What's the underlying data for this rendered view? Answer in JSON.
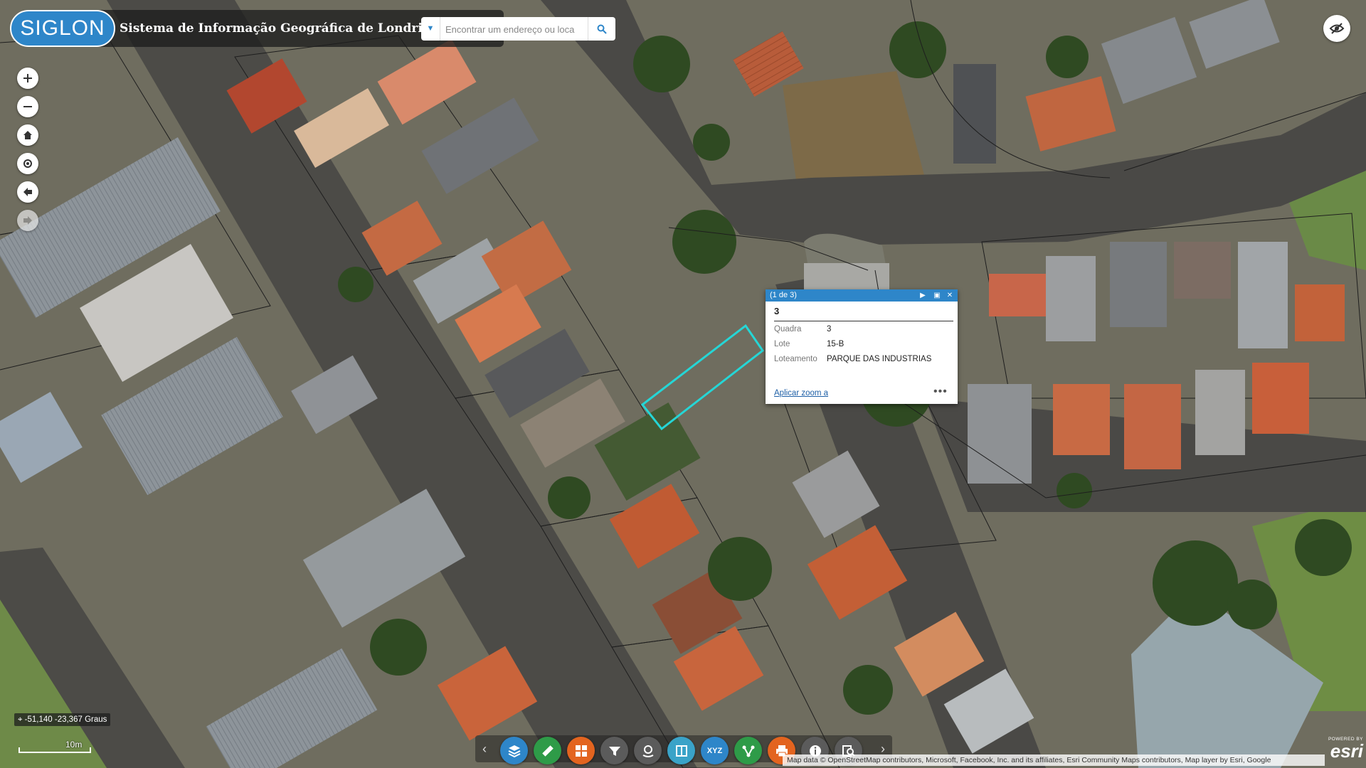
{
  "header": {
    "logo_text": "SIGLON",
    "title": "Sistema de Informação Geográfica de Londrina",
    "search_placeholder": "Encontrar um endereço ou loca"
  },
  "popup": {
    "counter": "(1 de 3)",
    "title": "3",
    "attributes": [
      {
        "label": "Quadra",
        "value": "3"
      },
      {
        "label": "Lote",
        "value": "15-B"
      },
      {
        "label": "Loteamento",
        "value": "PARQUE DAS INDUSTRIAS"
      }
    ],
    "zoom_link": "Aplicar zoom a",
    "more": "•••"
  },
  "coordinates": "-51,140 -23,367 Graus",
  "scale_label": "10m",
  "attribution": "Map data © OpenStreetMap contributors, Microsoft, Facebook, Inc. and its affiliates, Esri Community Maps contributors, Map layer by Esri, Google",
  "esri": {
    "powered_by": "POWERED BY",
    "logo": "esri"
  },
  "toolbar": {
    "tools": [
      {
        "name": "layers-icon",
        "color": "#2e86c9"
      },
      {
        "name": "measure-icon",
        "color": "#2e9b48"
      },
      {
        "name": "basemap-gallery-icon",
        "color": "#e3641f"
      },
      {
        "name": "filter-icon",
        "color": "#5b5b5b"
      },
      {
        "name": "location-icon",
        "color": "#5b5b5b"
      },
      {
        "name": "swipe-icon",
        "color": "#3aa3c8"
      },
      {
        "name": "xyz-icon",
        "color": "#2e86c9"
      },
      {
        "name": "network-icon",
        "color": "#2e9b48"
      },
      {
        "name": "print-icon",
        "color": "#e3641f"
      },
      {
        "name": "info-icon",
        "color": "#5b5b5b"
      },
      {
        "name": "query-icon",
        "color": "#5b5b5b"
      }
    ],
    "xyz_label": "XYZ"
  },
  "colors": {
    "accent": "#2e86c9",
    "selection": "#25d6d6"
  }
}
